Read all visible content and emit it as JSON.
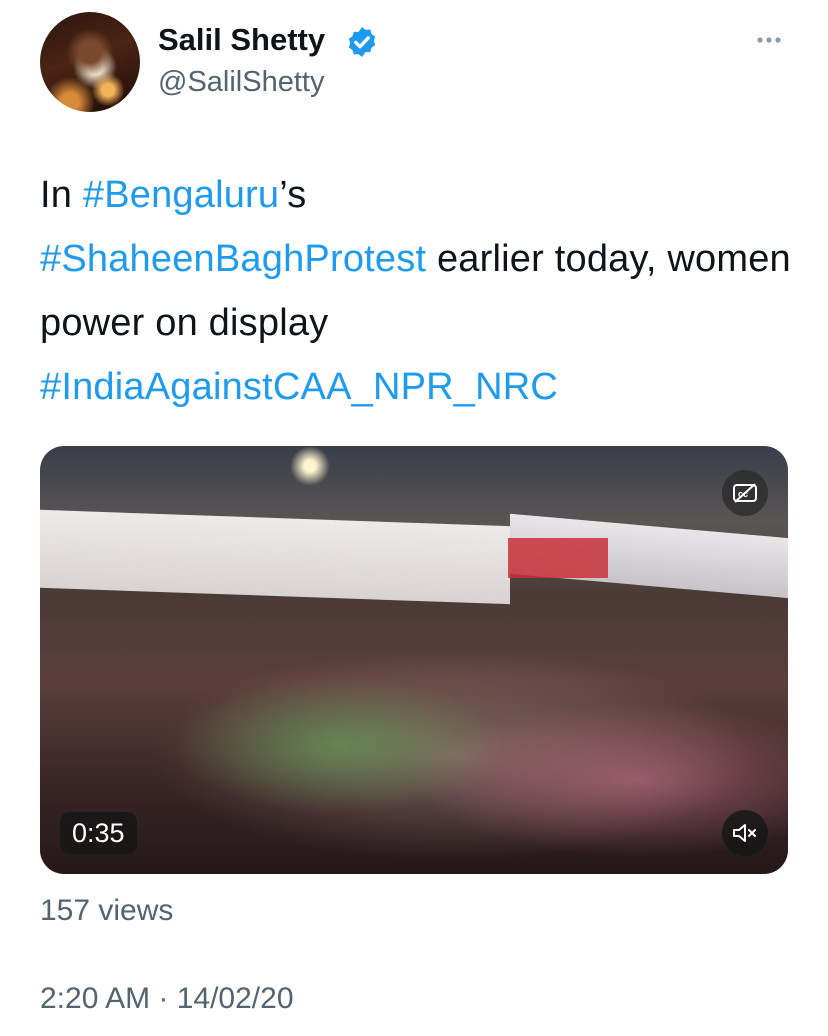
{
  "author": {
    "name": "Salil Shetty",
    "handle": "@SalilShetty"
  },
  "tweet": {
    "segments": [
      {
        "text": "In ",
        "type": "text"
      },
      {
        "text": "#Bengaluru",
        "type": "hashtag"
      },
      {
        "text": "’s ",
        "type": "text"
      },
      {
        "text": "#ShaheenBaghProtest",
        "type": "hashtag"
      },
      {
        "text": " earlier today, women power on display ",
        "type": "text"
      },
      {
        "text": "#IndiaAgainstCAA_NPR_NRC",
        "type": "hashtag"
      }
    ]
  },
  "video": {
    "duration": "0:35",
    "captions_icon": "closed-captions-off-icon",
    "mute_icon": "muted-speaker-icon"
  },
  "stats": {
    "views": "157 views"
  },
  "timestamp": "2:20 AM · 14/02/20",
  "colors": {
    "link": "#1d9bf0",
    "secondary_text": "#536471",
    "primary_text": "#0f1419",
    "verified": "#1d9bf0"
  }
}
